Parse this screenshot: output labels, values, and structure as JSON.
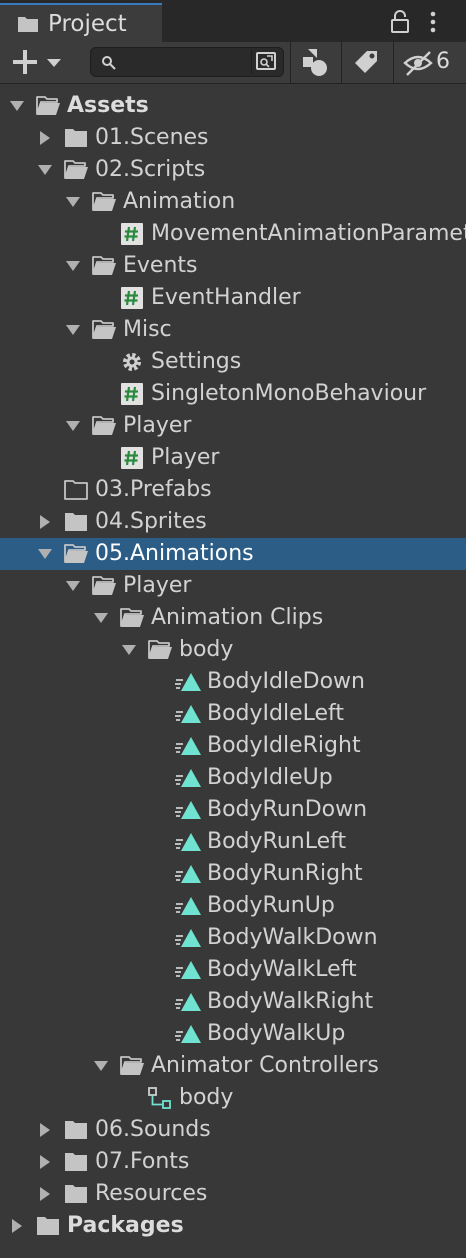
{
  "tab": {
    "title": "Project",
    "icon": "folder-icon"
  },
  "toolbar": {
    "create_icon": "plus-icon",
    "search_placeholder": "",
    "hidden_count": "6",
    "buttons": [
      "search-by-type-icon",
      "search-by-label-icon",
      "toggle-hidden-packages-icon"
    ]
  },
  "tree": [
    {
      "label": "Assets",
      "depth": 0,
      "icon": "folder-open",
      "arrow": "expanded",
      "bold": true
    },
    {
      "label": "01.Scenes",
      "depth": 1,
      "icon": "folder",
      "arrow": "collapsed"
    },
    {
      "label": "02.Scripts",
      "depth": 1,
      "icon": "folder-open",
      "arrow": "expanded"
    },
    {
      "label": "Animation",
      "depth": 2,
      "icon": "folder-open",
      "arrow": "expanded"
    },
    {
      "label": "MovementAnimationParameters",
      "depth": 3,
      "icon": "script"
    },
    {
      "label": "Events",
      "depth": 2,
      "icon": "folder-open",
      "arrow": "expanded"
    },
    {
      "label": "EventHandler",
      "depth": 3,
      "icon": "script"
    },
    {
      "label": "Misc",
      "depth": 2,
      "icon": "folder-open",
      "arrow": "expanded"
    },
    {
      "label": "Settings",
      "depth": 3,
      "icon": "settings"
    },
    {
      "label": "SingletonMonoBehaviour",
      "depth": 3,
      "icon": "script"
    },
    {
      "label": "Player",
      "depth": 2,
      "icon": "folder-open",
      "arrow": "expanded"
    },
    {
      "label": "Player",
      "depth": 3,
      "icon": "script"
    },
    {
      "label": "03.Prefabs",
      "depth": 1,
      "icon": "folder-empty"
    },
    {
      "label": "04.Sprites",
      "depth": 1,
      "icon": "folder",
      "arrow": "collapsed"
    },
    {
      "label": "05.Animations",
      "depth": 1,
      "icon": "folder-open",
      "arrow": "expanded",
      "selected": true
    },
    {
      "label": "Player",
      "depth": 2,
      "icon": "folder-open",
      "arrow": "expanded"
    },
    {
      "label": "Animation Clips",
      "depth": 3,
      "icon": "folder-open",
      "arrow": "expanded"
    },
    {
      "label": "body",
      "depth": 4,
      "icon": "folder-open",
      "arrow": "expanded"
    },
    {
      "label": "BodyIdleDown",
      "depth": 5,
      "icon": "anim-clip"
    },
    {
      "label": "BodyIdleLeft",
      "depth": 5,
      "icon": "anim-clip"
    },
    {
      "label": "BodyIdleRight",
      "depth": 5,
      "icon": "anim-clip"
    },
    {
      "label": "BodyIdleUp",
      "depth": 5,
      "icon": "anim-clip"
    },
    {
      "label": "BodyRunDown",
      "depth": 5,
      "icon": "anim-clip"
    },
    {
      "label": "BodyRunLeft",
      "depth": 5,
      "icon": "anim-clip"
    },
    {
      "label": "BodyRunRight",
      "depth": 5,
      "icon": "anim-clip"
    },
    {
      "label": "BodyRunUp",
      "depth": 5,
      "icon": "anim-clip"
    },
    {
      "label": "BodyWalkDown",
      "depth": 5,
      "icon": "anim-clip"
    },
    {
      "label": "BodyWalkLeft",
      "depth": 5,
      "icon": "anim-clip"
    },
    {
      "label": "BodyWalkRight",
      "depth": 5,
      "icon": "anim-clip"
    },
    {
      "label": "BodyWalkUp",
      "depth": 5,
      "icon": "anim-clip"
    },
    {
      "label": "Animator Controllers",
      "depth": 3,
      "icon": "folder-open",
      "arrow": "expanded"
    },
    {
      "label": "body",
      "depth": 4,
      "icon": "animator"
    },
    {
      "label": "06.Sounds",
      "depth": 1,
      "icon": "folder",
      "arrow": "collapsed"
    },
    {
      "label": "07.Fonts",
      "depth": 1,
      "icon": "folder",
      "arrow": "collapsed"
    },
    {
      "label": "Resources",
      "depth": 1,
      "icon": "folder",
      "arrow": "collapsed"
    },
    {
      "label": "Packages",
      "depth": 0,
      "icon": "folder",
      "arrow": "collapsed",
      "bold": true
    }
  ]
}
